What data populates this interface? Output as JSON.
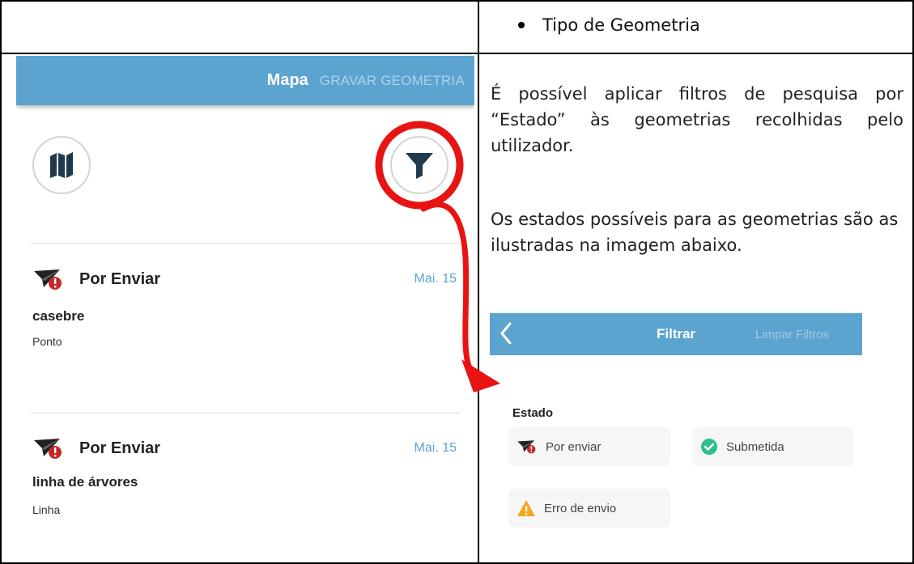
{
  "top_bullet": "Tipo de Geometria",
  "left_screen": {
    "appbar_title": "Mapa",
    "appbar_action": "GRAVAR GEOMETRIA",
    "buttons": [
      {
        "icon": "map-icon"
      },
      {
        "icon": "filter-icon"
      }
    ],
    "items": [
      {
        "status": "Por Enviar",
        "date": "Mai. 15",
        "name": "casebre",
        "type": "Ponto",
        "icon": "paper-plane-error-icon"
      },
      {
        "status": "Por Enviar",
        "date": "Mai. 15",
        "name": "linha de árvores",
        "type": "Linha",
        "icon": "paper-plane-error-icon"
      }
    ]
  },
  "paragraphs": [
    "É possível aplicar filtros de pesquisa por “Estado” às geometrias recolhidas pelo utilizador.",
    "Os estados possíveis para as geometrias são as ilustradas na imagem abaixo."
  ],
  "right_screen": {
    "title": "Filtrar",
    "clear_action": "Limpar Filtros",
    "section_label": "Estado",
    "chips": [
      {
        "label": "Por enviar",
        "icon": "paper-plane-error-icon"
      },
      {
        "label": "Submetida",
        "icon": "check-circle-icon"
      },
      {
        "label": "Erro de envio",
        "icon": "warning-icon"
      }
    ]
  },
  "colors": {
    "appbar": "#5ba4d0",
    "highlight": "#e81414",
    "success": "#2dbf8f",
    "warning": "#f5a623"
  }
}
